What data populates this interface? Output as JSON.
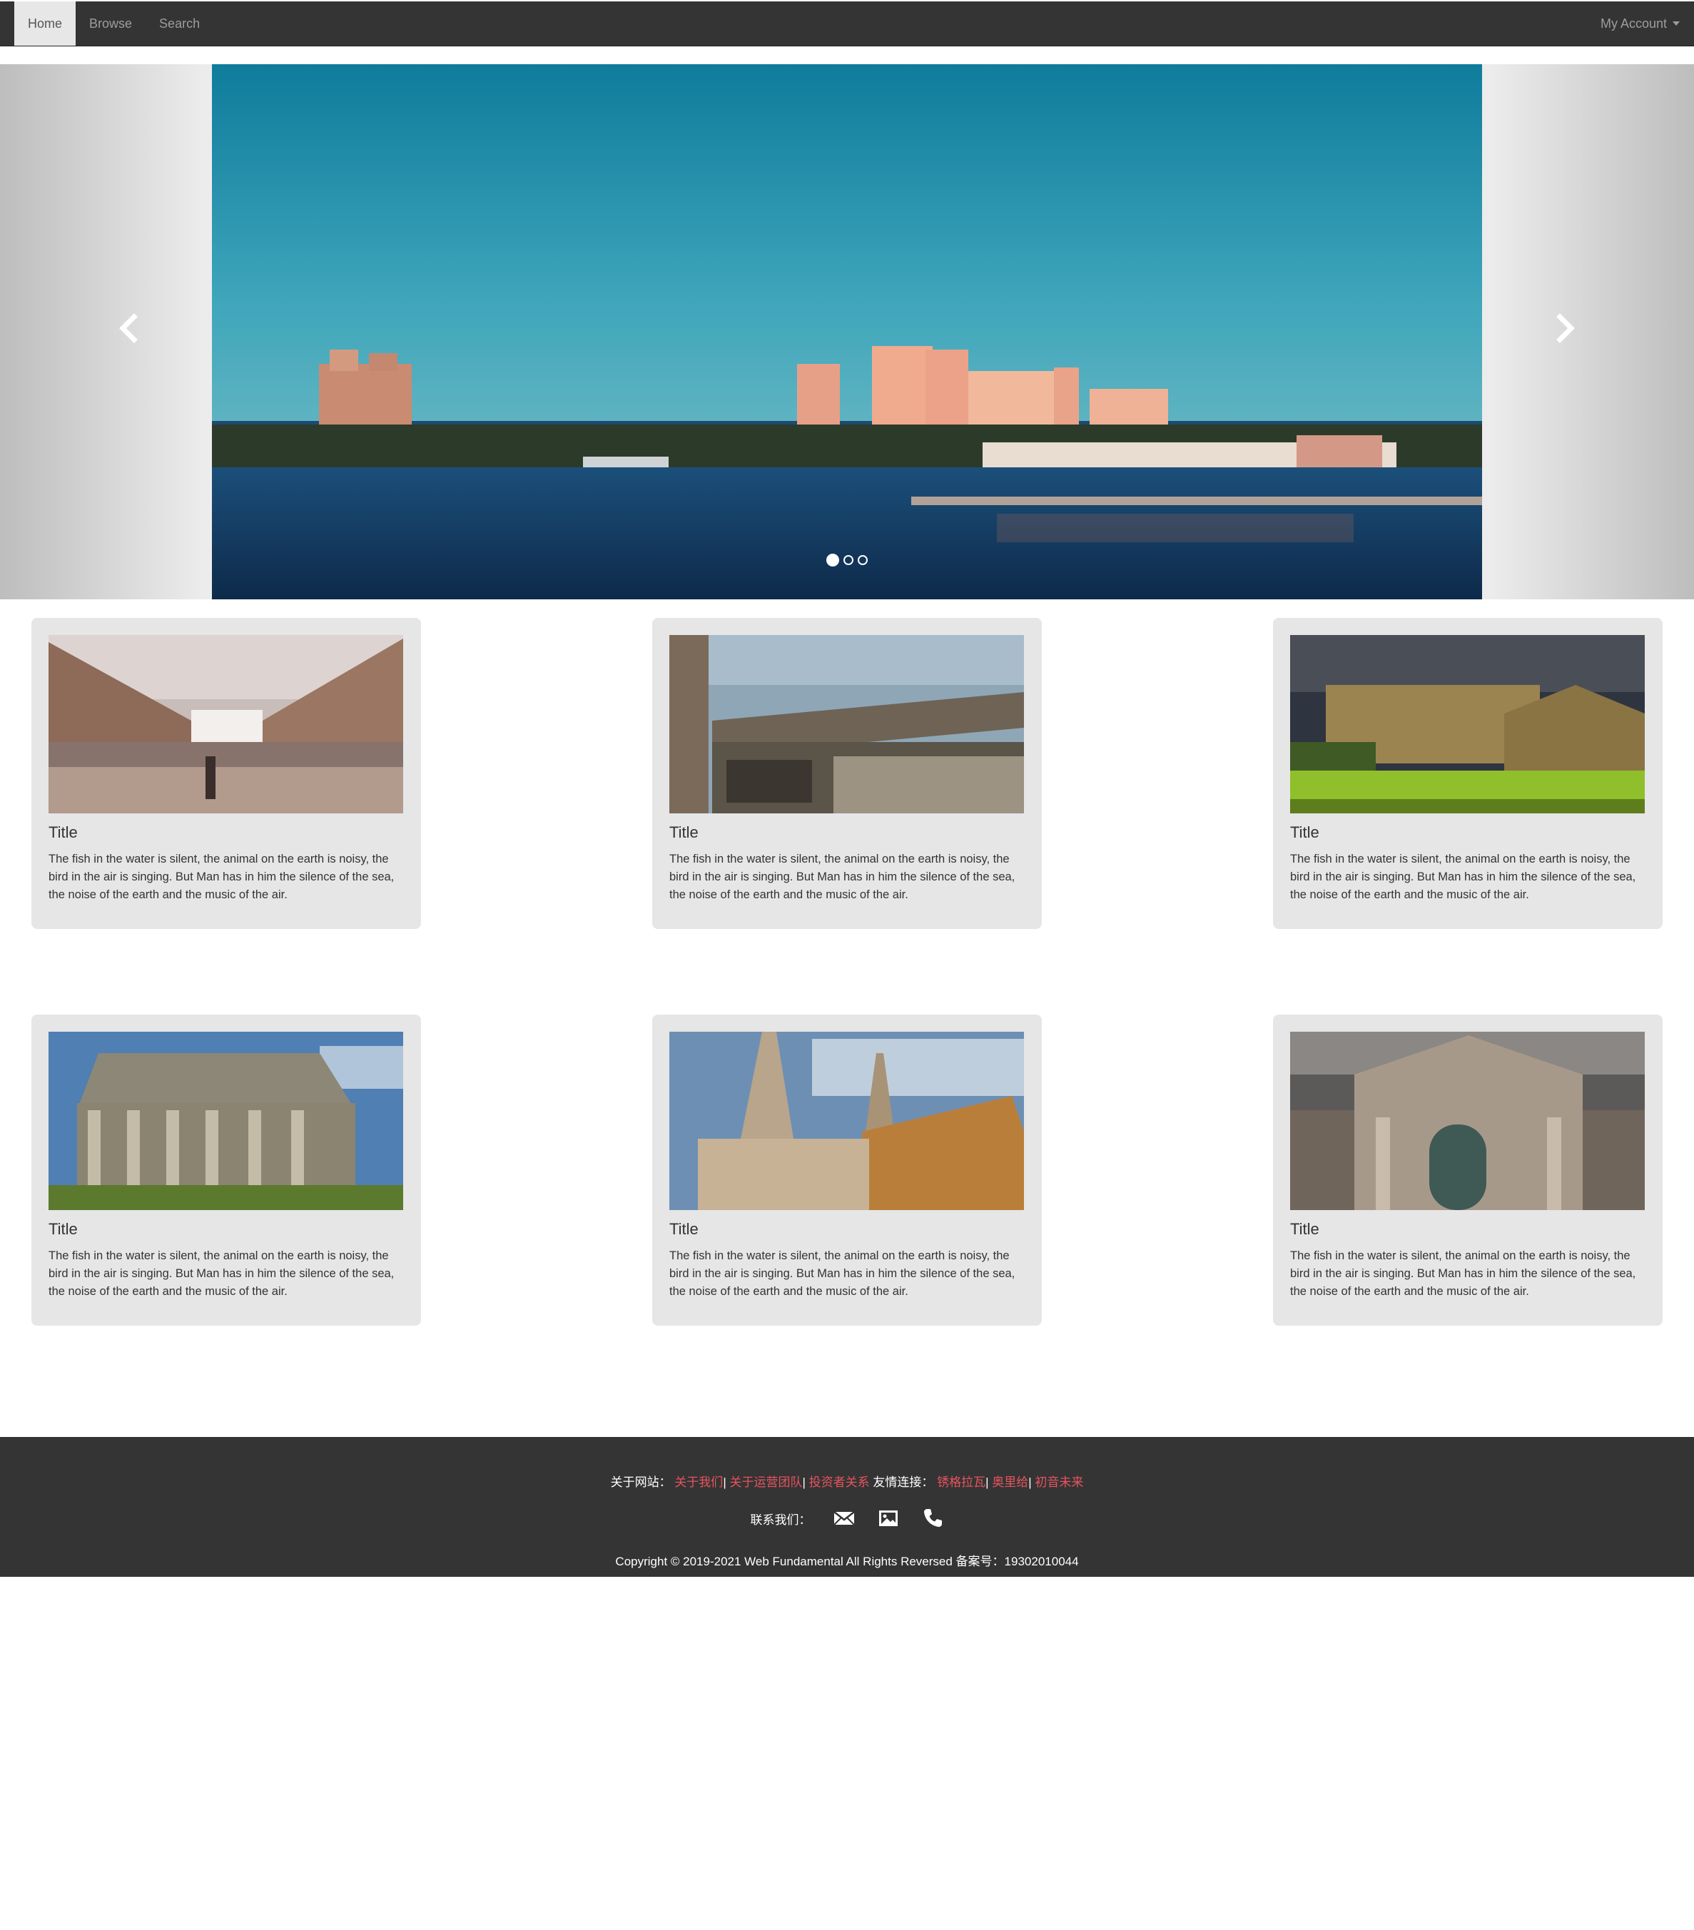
{
  "navbar": {
    "items": [
      {
        "label": "Home",
        "active": true
      },
      {
        "label": "Browse",
        "active": false
      },
      {
        "label": "Search",
        "active": false
      }
    ],
    "account_label": "My Account"
  },
  "carousel": {
    "slide_count": 3,
    "active_index": 0,
    "prev_icon": "chevron-left-icon",
    "next_icon": "chevron-right-icon"
  },
  "cards": [
    {
      "title": "Title",
      "text": "The fish in the water is silent, the animal on the earth is noisy, the bird in the air is singing. But Man has in him the silence of the sea, the noise of the earth and the music of the air."
    },
    {
      "title": "Title",
      "text": "The fish in the water is silent, the animal on the earth is noisy, the bird in the air is singing. But Man has in him the silence of the sea, the noise of the earth and the music of the air."
    },
    {
      "title": "Title",
      "text": "The fish in the water is silent, the animal on the earth is noisy, the bird in the air is singing. But Man has in him the silence of the sea, the noise of the earth and the music of the air."
    },
    {
      "title": "Title",
      "text": "The fish in the water is silent, the animal on the earth is noisy, the bird in the air is singing. But Man has in him the silence of the sea, the noise of the earth and the music of the air."
    },
    {
      "title": "Title",
      "text": "The fish in the water is silent, the animal on the earth is noisy, the bird in the air is singing. But Man has in him the silence of the sea, the noise of the earth and the music of the air."
    },
    {
      "title": "Title",
      "text": "The fish in the water is silent, the animal on the earth is noisy, the bird in the air is singing. But Man has in him the silence of the sea, the noise of the earth and the music of the air."
    }
  ],
  "footer": {
    "about_label": "关于网站：",
    "about_links": [
      "关于我们",
      "关于运营团队",
      "投资者关系"
    ],
    "friends_label": "友情连接：",
    "friend_links": [
      "锈格拉瓦",
      "奥里给",
      "初音未来"
    ],
    "separator": "|",
    "contact_label": "联系我们：",
    "contact_icons": [
      "envelope-icon",
      "picture-icon",
      "phone-icon"
    ],
    "copyright": "Copyright © 2019-2021 Web Fundamental All Rights Reversed 备案号：19302010044"
  },
  "colors": {
    "navbar_bg": "#343434",
    "card_bg": "#e6e6e6",
    "footer_link": "#e8535f"
  }
}
